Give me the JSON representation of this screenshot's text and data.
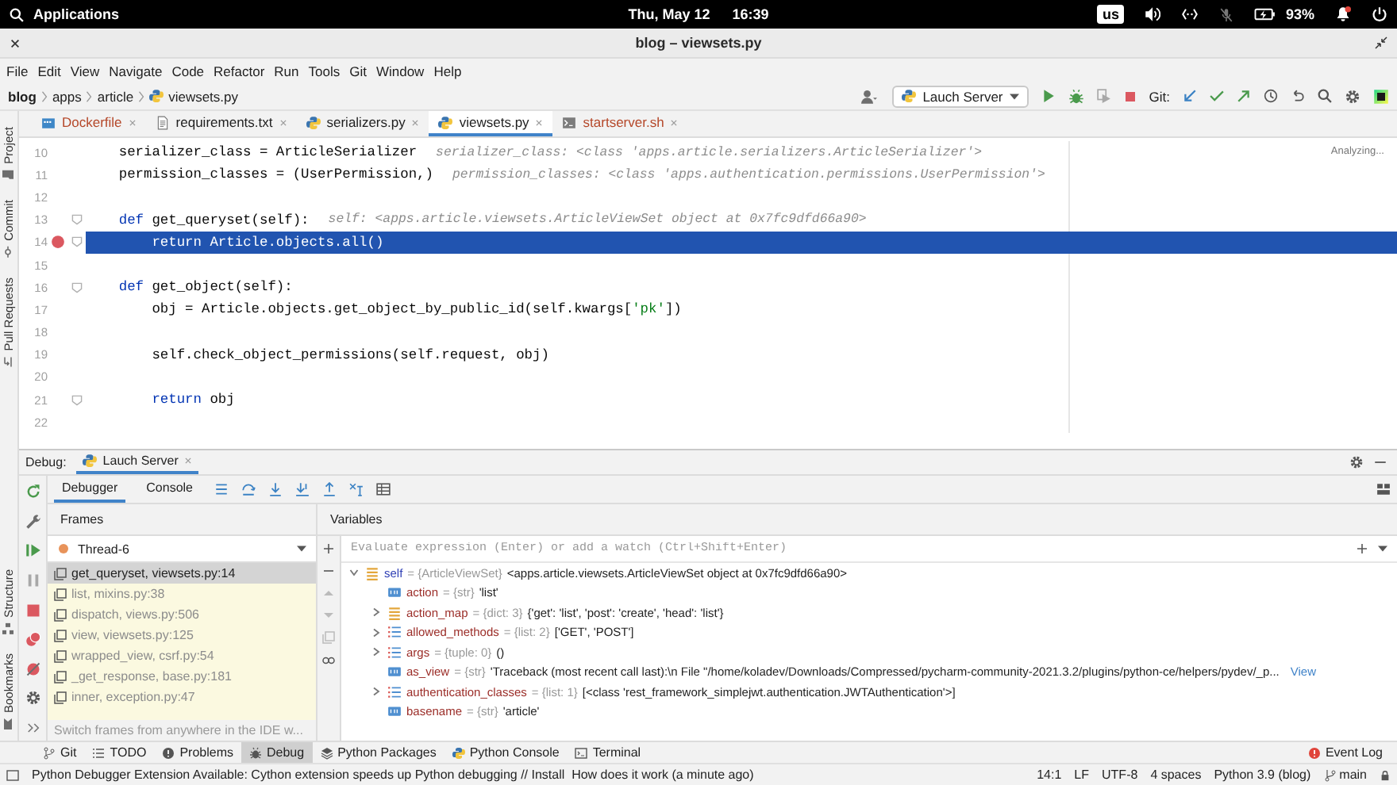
{
  "system_bar": {
    "menu": "Applications",
    "date": "Thu, May 12",
    "time": "16:39",
    "keyboard_layout": "us",
    "battery": "93%"
  },
  "window": {
    "title": "blog – viewsets.py"
  },
  "menu": [
    "File",
    "Edit",
    "View",
    "Navigate",
    "Code",
    "Refactor",
    "Run",
    "Tools",
    "Git",
    "Window",
    "Help"
  ],
  "breadcrumb": [
    "blog",
    "apps",
    "article",
    "viewsets.py"
  ],
  "toolbar": {
    "run_configuration": "Lauch Server",
    "git_label": "Git:"
  },
  "left_tool_windows": [
    {
      "label": "Project",
      "kind": "project"
    },
    {
      "label": "Commit",
      "kind": "commit"
    },
    {
      "label": "Pull Requests",
      "kind": "pull_requests"
    }
  ],
  "lower_left_tool_windows": [
    {
      "label": "Structure",
      "kind": "structure"
    },
    {
      "label": "Bookmarks",
      "kind": "bookmarks"
    }
  ],
  "tabs": [
    {
      "label": "Dockerfile",
      "kind": "docker",
      "color": "#b5482a",
      "selected": false
    },
    {
      "label": "requirements.txt",
      "kind": "text",
      "color": "#1f1f1f",
      "selected": false
    },
    {
      "label": "serializers.py",
      "kind": "python",
      "color": "#1f1f1f",
      "selected": false
    },
    {
      "label": "viewsets.py",
      "kind": "python",
      "color": "#1f1f1f",
      "selected": true
    },
    {
      "label": "startserver.sh",
      "kind": "shell",
      "color": "#b5482a",
      "selected": false
    }
  ],
  "editor": {
    "status": "Analyzing...",
    "lines": [
      {
        "number": "10",
        "tokens": [
          {
            "kind": "plain",
            "text": "    serializer_class = ArticleSerializer"
          }
        ],
        "hint": "serializer_class: <class 'apps.article.serializers.ArticleSerializer'>",
        "breakpoint": false,
        "current": false,
        "fold": false
      },
      {
        "number": "11",
        "tokens": [
          {
            "kind": "plain",
            "text": "    permission_classes = (UserPermission,)"
          }
        ],
        "hint": "permission_classes: <class 'apps.authentication.permissions.UserPermission'>",
        "breakpoint": false,
        "current": false,
        "fold": false
      },
      {
        "number": "12",
        "breakpoint": false,
        "current": false,
        "fold": false
      },
      {
        "number": "13",
        "tokens": [
          {
            "kind": "keyword",
            "text": "    def"
          },
          {
            "kind": "plain",
            "text": " get_queryset(self):"
          }
        ],
        "hint": "self: <apps.article.viewsets.ArticleViewSet object at 0x7fc9dfd66a90>",
        "breakpoint": false,
        "current": false,
        "fold": true
      },
      {
        "number": "14",
        "tokens": [
          {
            "kind": "keyword",
            "text": "        return"
          },
          {
            "kind": "plain",
            "text": " Article.objects.all()"
          }
        ],
        "breakpoint": true,
        "current": true,
        "fold": true
      },
      {
        "number": "15",
        "breakpoint": false,
        "current": false,
        "fold": false
      },
      {
        "number": "16",
        "tokens": [
          {
            "kind": "keyword",
            "text": "    def"
          },
          {
            "kind": "plain",
            "text": " get_object(self):"
          }
        ],
        "breakpoint": false,
        "current": false,
        "fold": true
      },
      {
        "number": "17",
        "tokens": [
          {
            "kind": "plain",
            "text": "        obj = Article.objects.get_object_by_public_id(self.kwargs["
          },
          {
            "kind": "string",
            "text": "'pk'"
          },
          {
            "kind": "plain",
            "text": "])"
          }
        ],
        "breakpoint": false,
        "current": false,
        "fold": false
      },
      {
        "number": "18",
        "breakpoint": false,
        "current": false,
        "fold": false
      },
      {
        "number": "19",
        "tokens": [
          {
            "kind": "plain",
            "text": "        self.check_object_permissions(self.request, obj)"
          }
        ],
        "breakpoint": false,
        "current": false,
        "fold": false
      },
      {
        "number": "20",
        "breakpoint": false,
        "current": false,
        "fold": false
      },
      {
        "number": "21",
        "tokens": [
          {
            "kind": "keyword",
            "text": "        return"
          },
          {
            "kind": "plain",
            "text": " obj"
          }
        ],
        "breakpoint": false,
        "current": false,
        "fold": true
      },
      {
        "number": "22",
        "breakpoint": false,
        "current": false,
        "fold": false
      }
    ]
  },
  "debug": {
    "label": "Debug:",
    "session": "Lauch Server",
    "tabs": [
      {
        "label": "Debugger",
        "selected": true
      },
      {
        "label": "Console",
        "selected": false
      }
    ],
    "frames_header": "Frames",
    "variables_header": "Variables",
    "thread": "Thread-6",
    "watch_placeholder": "Evaluate expression (Enter) or add a watch (Ctrl+Shift+Enter)",
    "frames": [
      {
        "label": "get_queryset, viewsets.py:14",
        "selected": true,
        "library": false
      },
      {
        "label": "list, mixins.py:38",
        "selected": false,
        "library": true
      },
      {
        "label": "dispatch, views.py:506",
        "selected": false,
        "library": true
      },
      {
        "label": "view, viewsets.py:125",
        "selected": false,
        "library": true
      },
      {
        "label": "wrapped_view, csrf.py:54",
        "selected": false,
        "library": true
      },
      {
        "label": "_get_response, base.py:181",
        "selected": false,
        "library": true
      },
      {
        "label": "inner, exception.py:47",
        "selected": false,
        "library": true
      }
    ],
    "frames_hint": "Switch frames from anywhere in the IDE w...",
    "variables": [
      {
        "name": "self",
        "kind": "object",
        "type": "= {ArticleViewSet}",
        "value": "<apps.article.viewsets.ArticleViewSet object at 0x7fc9dfd66a90>",
        "expanded": true,
        "children": [
          {
            "name": "action",
            "kind": "str",
            "type": "= {str}",
            "value": "'list'"
          },
          {
            "name": "action_map",
            "kind": "dict",
            "type": "= {dict: 3}",
            "value": "{'get': 'list', 'post': 'create', 'head': 'list'}",
            "expanded": false
          },
          {
            "name": "allowed_methods",
            "kind": "list",
            "type": "= {list: 2}",
            "value": "['GET', 'POST']",
            "expanded": false
          },
          {
            "name": "args",
            "kind": "list",
            "type": "= {tuple: 0}",
            "value": "()",
            "expanded": false
          },
          {
            "name": "as_view",
            "kind": "str",
            "type": "= {str}",
            "value": "'Traceback (most recent call last):\\n  File \"/home/koladev/Downloads/Compressed/pycharm-community-2021.3.2/plugins/python-ce/helpers/pydev/_p...",
            "link": "View"
          },
          {
            "name": "authentication_classes",
            "kind": "list",
            "type": "= {list: 1}",
            "value": "[<class 'rest_framework_simplejwt.authentication.JWTAuthentication'>]",
            "expanded": false
          },
          {
            "name": "basename",
            "kind": "str",
            "type": "= {str}",
            "value": "'article'"
          }
        ]
      }
    ]
  },
  "tool_windows": [
    {
      "label": "Git",
      "kind": "git",
      "selected": false
    },
    {
      "label": "TODO",
      "kind": "todo",
      "selected": false
    },
    {
      "label": "Problems",
      "kind": "problems",
      "selected": false
    },
    {
      "label": "Debug",
      "kind": "debug",
      "selected": true
    },
    {
      "label": "Python Packages",
      "kind": "packages",
      "selected": false
    },
    {
      "label": "Python Console",
      "kind": "console",
      "selected": false
    },
    {
      "label": "Terminal",
      "kind": "terminal",
      "selected": false
    }
  ],
  "event_log": "Event Log",
  "status_bar": {
    "message": "Python Debugger Extension Available: Cython extension speeds up Python debugging // Install  How does it work (a minute ago)",
    "position": "14:1",
    "line_separator": "LF",
    "encoding": "UTF-8",
    "indent": "4 spaces",
    "interpreter": "Python 3.9 (blog)",
    "branch": "main"
  }
}
